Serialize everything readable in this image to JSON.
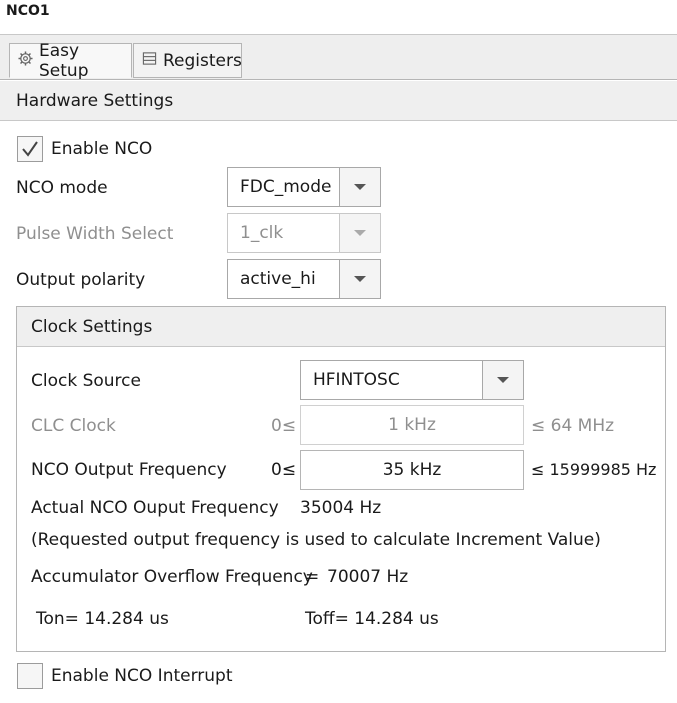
{
  "window": {
    "title": "NCO1"
  },
  "tabs": [
    {
      "label": "Easy Setup",
      "icon": "gear-icon"
    },
    {
      "label": "Registers",
      "icon": "list-icon"
    }
  ],
  "hardware": {
    "title": "Hardware Settings",
    "enable_nco": {
      "label": "Enable NCO",
      "checked": true
    },
    "nco_mode": {
      "label": "NCO mode",
      "value": "FDC_mode"
    },
    "pulse_width": {
      "label": "Pulse Width Select",
      "value": "1_clk",
      "enabled": false
    },
    "output_polarity": {
      "label": "Output polarity",
      "value": "active_hi"
    }
  },
  "clock": {
    "title": "Clock Settings",
    "source": {
      "label": "Clock Source",
      "value": "HFINTOSC"
    },
    "clc_clock": {
      "label": "CLC Clock",
      "min": "0≤",
      "value": "1 kHz",
      "max": "≤ 64 MHz",
      "enabled": false
    },
    "output_freq": {
      "label": "NCO Output Frequency",
      "min": "0≤",
      "value": "35 kHz",
      "max": "≤ 15999985 Hz"
    },
    "actual": {
      "label": "Actual NCO Ouput Frequency",
      "value": "35004 Hz"
    },
    "note": "(Requested output frequency is used to calculate Increment Value)",
    "overflow": {
      "label": "Accumulator Overflow Frequency",
      "eq": "=",
      "value": "70007 Hz"
    },
    "ton": "Ton= 14.284 us",
    "toff": "Toff= 14.284 us"
  },
  "interrupt": {
    "label": "Enable NCO Interrupt",
    "checked": false
  }
}
